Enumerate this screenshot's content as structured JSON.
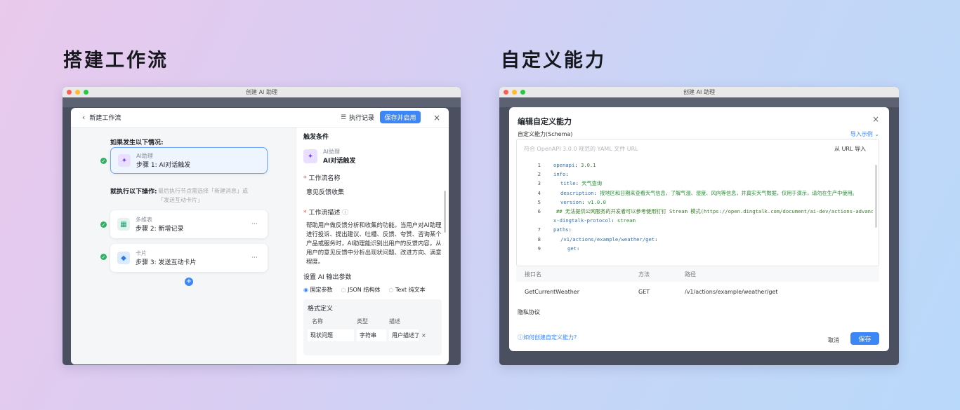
{
  "left_heading": "搭建工作流",
  "right_heading": "自定义能力",
  "colors": {
    "primary": "#3c86f6",
    "success": "#2fb063",
    "code_key": "#2f6fb5",
    "code_string": "#2e8a3a"
  },
  "left_window": {
    "title": "创建 AI 助理",
    "header": {
      "back_label": "新建工作流",
      "log_label": "执行记录",
      "save_label": "保存并启用",
      "close": "×"
    },
    "flow": {
      "if_label": "如果发生以下情况:",
      "trigger": {
        "type": "AI助理",
        "label": "步骤 1: AI对话触发"
      },
      "then_label": "就执行以下操作:",
      "then_hint": "最后执行节点需选择「新建消息」或「发送互动卡片」",
      "steps": [
        {
          "type": "多维表",
          "label": "步骤 2: 新增记录",
          "menu": "···",
          "icon": "table-icon"
        },
        {
          "type": "卡片",
          "label": "步骤 3: 发送互动卡片",
          "menu": "···",
          "icon": "card-icon"
        }
      ],
      "add": "+"
    },
    "panel": {
      "section": "触发条件",
      "trigger_type": "AI助理",
      "trigger_name": "AI对话触发",
      "name_label": "工作流名称",
      "name_value": "意见反馈收集",
      "desc_label": "工作流描述",
      "desc_value": "帮助用户做反馈分析和收集的功能。当用户对AI助理进行投诉、提出建议、吐槽、反馈、夸赞、咨询某个产品或服务时，AI助理能识别出用户的反馈内容，从用户的意见反馈中分析出现状问题、改进方向、满意程度。",
      "ai_params_label": "设置 AI 输出参数",
      "options": [
        "固定参数",
        "JSON 结构体",
        "Text 纯文本"
      ],
      "format_label": "格式定义",
      "table_headers": [
        "名称",
        "类型",
        "描述"
      ],
      "row": {
        "name": "现状问题",
        "type": "字符串",
        "desc": "用户描述了"
      }
    }
  },
  "right_window": {
    "title": "创建 AI 助理",
    "modal_title": "编辑自定义能力",
    "schema_label": "自定义能力(Schema)",
    "import_example": "导入示例",
    "url_placeholder": "符合 OpenAPI 3.0.0 规范的 YAML 文件 URL",
    "url_import": "从 URL 导入",
    "code": [
      {
        "n": "1",
        "key": "openapi",
        "val": "3.0.1",
        "indent": 1
      },
      {
        "n": "2",
        "key": "info",
        "val": "",
        "indent": 1
      },
      {
        "n": "3",
        "key": "title",
        "val": "天气查询",
        "indent": 2
      },
      {
        "n": "4",
        "key": "description",
        "val": "按地区和日期来查看天气信息，了解气温、湿度、风向等信息，并真实天气数据，仅用于演示，请勿在生产中使用。",
        "indent": 2
      },
      {
        "n": "5",
        "key": "version",
        "val": "v1.0.0",
        "indent": 2
      },
      {
        "n": "6",
        "key": "",
        "val": "## 无法提供公网服务的开发者可以参考使用钉钉 Stream 模式(https://open.dingtalk.com/document/ai-dev/actions-advanced-",
        "indent": 1,
        "comment": true
      },
      {
        "n": "",
        "key": "x-dingtalk-protocol",
        "val": "stream",
        "indent": 1
      },
      {
        "n": "7",
        "key": "paths",
        "val": "",
        "indent": 1
      },
      {
        "n": "8",
        "key": "/v1/actions/example/weather/get",
        "val": "",
        "indent": 2
      },
      {
        "n": "9",
        "key": "get",
        "val": "",
        "indent": 3
      }
    ],
    "api_headers": [
      "接口名",
      "方法",
      "路径"
    ],
    "api_row": {
      "name": "GetCurrentWeather",
      "method": "GET",
      "path": "/v1/actions/example/weather/get"
    },
    "privacy_label": "隐私协议",
    "help_link": "如何创建自定义能力?",
    "cancel": "取消",
    "save": "保存",
    "close": "×"
  }
}
